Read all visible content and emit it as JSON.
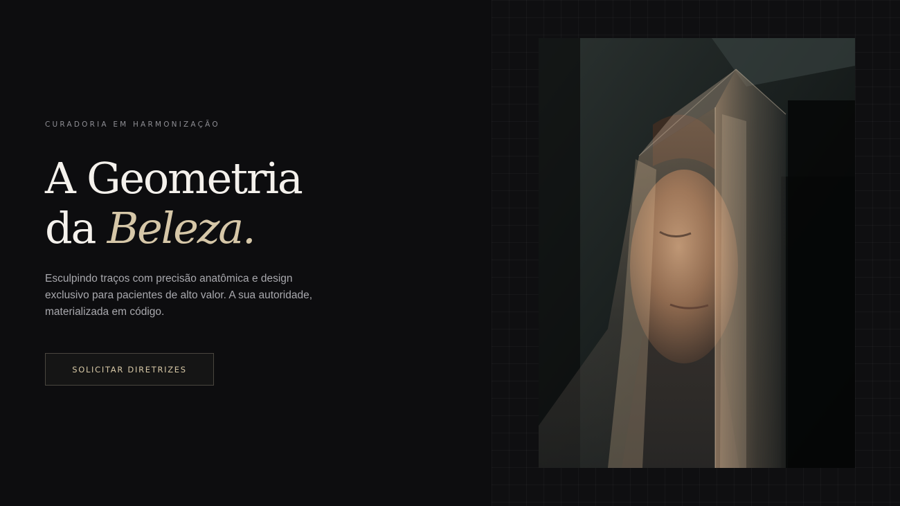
{
  "hero": {
    "eyebrow": "CURADORIA EM HARMONIZAÇÃO",
    "headline_line1": "A Geometria",
    "headline_line2_prefix": "da ",
    "headline_accent": "Beleza.",
    "description": "Esculpindo traços com precisão anatômica e design exclusivo para pacientes de alto valor. A sua autoridade, materializada em código.",
    "cta_label": "SOLICITAR DIRETRIZES"
  },
  "colors": {
    "background": "#0d0d0f",
    "accent": "#d6c7a8",
    "headline": "#f4f1ec",
    "body_text": "#a9a9ae"
  }
}
